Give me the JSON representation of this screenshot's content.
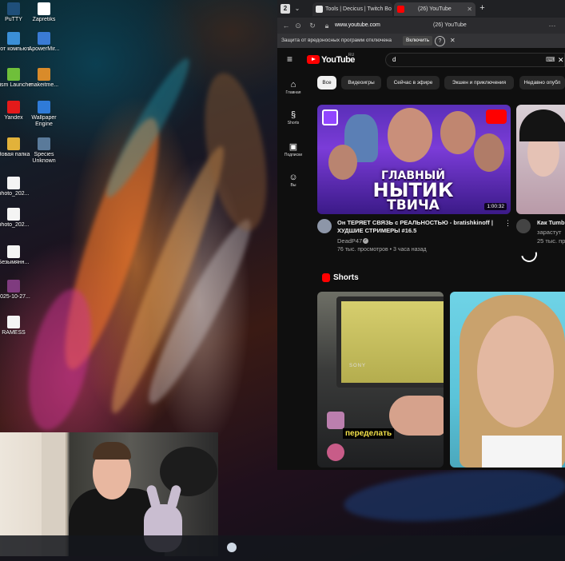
{
  "desktop": {
    "icons": [
      {
        "label": "PuTTY"
      },
      {
        "label": "Zapretiks"
      },
      {
        "label": "Этот компьют..."
      },
      {
        "label": "ApowerMir..."
      },
      {
        "label": "Prism Launcher"
      },
      {
        "label": "makeitme..."
      },
      {
        "label": "Yandex"
      },
      {
        "label": "Wallpaper Engine"
      },
      {
        "label": "Новая папка"
      },
      {
        "label": "Species Unknown"
      },
      {
        "label": "photo_202..."
      },
      {
        "label": "photo_202..."
      },
      {
        "label": "Безымянн..."
      },
      {
        "label": "2025-10-27..."
      },
      {
        "label": "RAMESS"
      }
    ]
  },
  "browser": {
    "tabs": [
      {
        "label": "Tools | Decicus | Twitch Bo",
        "favicon_color": "#e6e6e6"
      },
      {
        "label": "(26) YouTube",
        "favicon_color": "#ff0000"
      }
    ],
    "address": {
      "url": "www.youtube.com",
      "page_title": "(26) YouTube"
    },
    "infobar": {
      "text": "Защита от вредоносных программ отключена",
      "button": "Включить"
    }
  },
  "youtube": {
    "logo_text": "YouTube",
    "region": "RU",
    "search_value": "d",
    "guide": [
      {
        "icon": "⌂",
        "label": "Главная"
      },
      {
        "icon": "§",
        "label": "Shorts"
      },
      {
        "icon": "▣",
        "label": "Подписки"
      },
      {
        "icon": "☺",
        "label": "Вы"
      }
    ],
    "chips": [
      "Все",
      "Видеоигры",
      "Сейчас в эфире",
      "Экшен и приключения",
      "Недавно опубл"
    ],
    "video1": {
      "thumb_text_line1": "ГЛАВНЫЙ",
      "thumb_text_line2": "НЫТИК",
      "thumb_text_line3": "ТВИЧА",
      "duration": "1:00:32",
      "title": "Он ТЕРЯЕТ СВЯЗЬ с РЕАЛЬНОСТЬЮ - bratishkinoff | ХУДШИЕ СТРИМЕРЫ #16.5",
      "channel": "DeadP47",
      "stats": "76 тыс. просмотров • 3 часа назад"
    },
    "video2": {
      "title": "Как Tumb",
      "channel": "зарастут",
      "stats": "25 тыс. пр"
    },
    "shorts_heading": "Shorts",
    "short1_caption": "переделать",
    "short1_brand": "SONY"
  }
}
